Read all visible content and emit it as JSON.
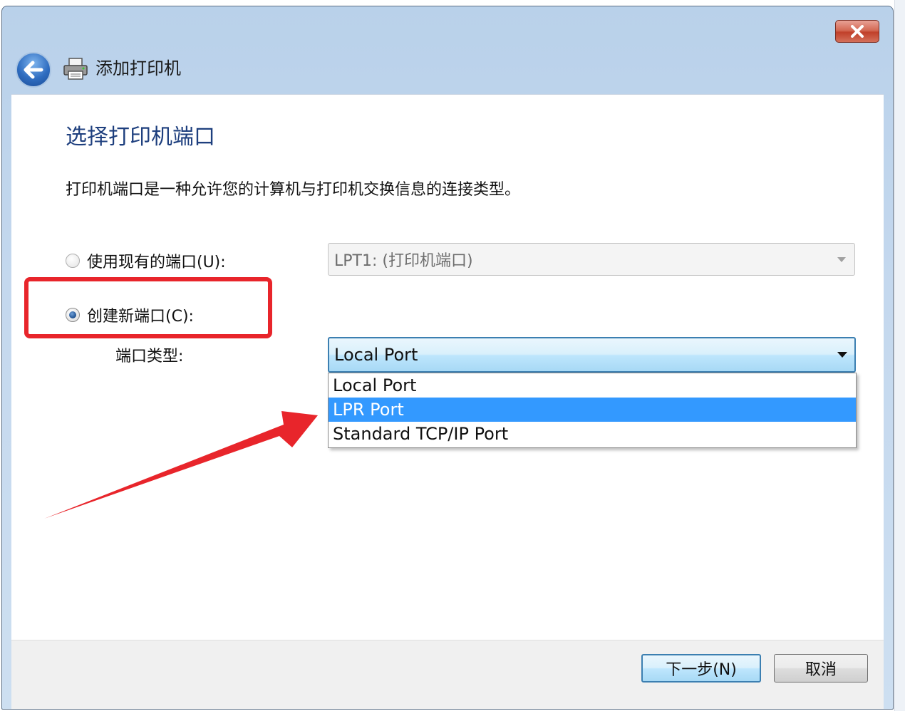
{
  "window": {
    "title": "添加打印机",
    "close_icon": "close-icon",
    "back_icon": "back-arrow-icon",
    "printer_icon": "printer-icon"
  },
  "page": {
    "heading": "选择打印机端口",
    "description": "打印机端口是一种允许您的计算机与打印机交换信息的连接类型。"
  },
  "options": {
    "use_existing": {
      "label": "使用现有的端口(U):",
      "selected": false,
      "combo_value": "LPT1: (打印机端口)"
    },
    "create_new": {
      "label": "创建新端口(C):",
      "selected": true
    }
  },
  "port_type": {
    "label": "端口类型:",
    "value": "Local Port",
    "options": [
      "Local Port",
      "LPR Port",
      "Standard TCP/IP Port"
    ],
    "highlighted": "LPR Port"
  },
  "footer": {
    "next_label": "下一步(N)",
    "cancel_label": "取消"
  },
  "annotation": {
    "box_color": "#e8252b",
    "arrow_color": "#e8252b"
  }
}
